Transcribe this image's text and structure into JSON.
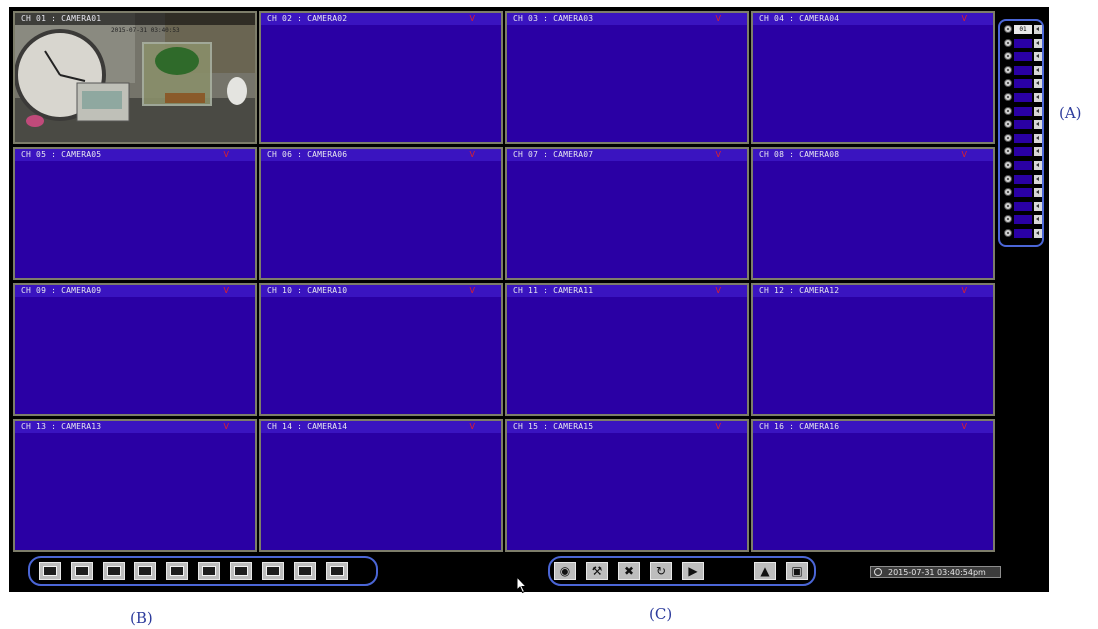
{
  "channels": [
    {
      "title": "CH 01 : CAMERA01",
      "rec": "",
      "live": true,
      "osd": "2015-07-31 03:40:53"
    },
    {
      "title": "CH 02 : CAMERA02",
      "rec": "V"
    },
    {
      "title": "CH 03 : CAMERA03",
      "rec": "V"
    },
    {
      "title": "CH 04 : CAMERA04",
      "rec": "V"
    },
    {
      "title": "CH 05 : CAMERA05",
      "rec": "V"
    },
    {
      "title": "CH 06 : CAMERA06",
      "rec": "V"
    },
    {
      "title": "CH 07 : CAMERA07",
      "rec": "V"
    },
    {
      "title": "CH 08 : CAMERA08",
      "rec": "V"
    },
    {
      "title": "CH 09 : CAMERA09",
      "rec": "V"
    },
    {
      "title": "CH 10 : CAMERA10",
      "rec": "V"
    },
    {
      "title": "CH 11 : CAMERA11",
      "rec": "V"
    },
    {
      "title": "CH 12 : CAMERA12",
      "rec": "V"
    },
    {
      "title": "CH 13 : CAMERA13",
      "rec": "V"
    },
    {
      "title": "CH 14 : CAMERA14",
      "rec": "V"
    },
    {
      "title": "CH 15 : CAMERA15",
      "rec": "V"
    },
    {
      "title": "CH 16 : CAMERA16",
      "rec": "V"
    }
  ],
  "channel_panel": {
    "selected_label": "01",
    "rows": 16
  },
  "layout_toolbar": [
    {
      "name": "layout-1-icon"
    },
    {
      "name": "layout-4-icon"
    },
    {
      "name": "layout-6-icon"
    },
    {
      "name": "layout-8-icon"
    },
    {
      "name": "layout-9-icon"
    },
    {
      "name": "layout-10-icon"
    },
    {
      "name": "layout-16-icon"
    },
    {
      "name": "layout-pip-icon"
    },
    {
      "name": "fullscreen-layout-icon"
    },
    {
      "name": "sequence-icon"
    }
  ],
  "function_toolbar": [
    {
      "name": "search-disk-icon"
    },
    {
      "name": "setup-icon"
    },
    {
      "name": "tools-icon"
    },
    {
      "name": "refresh-icon"
    },
    {
      "name": "playback-icon"
    },
    {
      "name": "alarm-icon"
    },
    {
      "name": "snapshot-icon"
    }
  ],
  "clock": {
    "text": "2015-07-31 03:40:54pm"
  },
  "callouts": {
    "a": "(A)",
    "b": "(B)",
    "c": "(C)"
  },
  "colors": {
    "video_bg": "#2a00a4",
    "rec_mark": "#e0202a",
    "callout_border": "#4b66d6"
  }
}
